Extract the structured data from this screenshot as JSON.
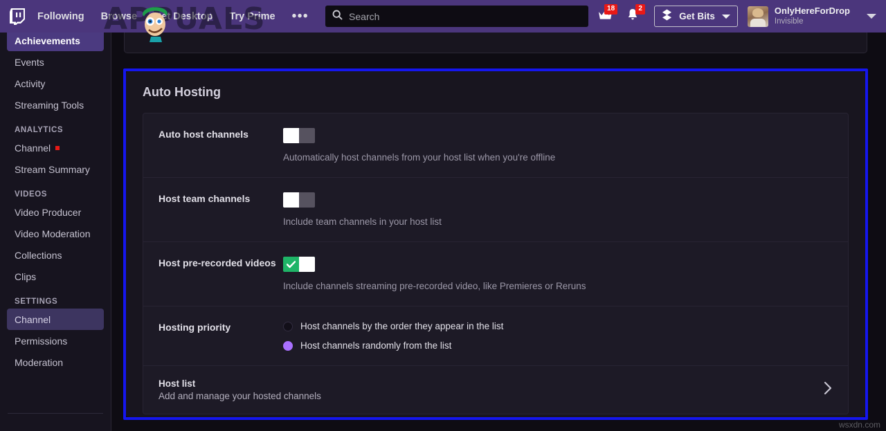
{
  "nav": {
    "logo": "twitch-logo",
    "links": [
      {
        "label": "Following"
      },
      {
        "label": "Browse"
      },
      {
        "label": "Get Desktop"
      },
      {
        "label": "Try Prime"
      }
    ],
    "more_label": "•••",
    "search": {
      "placeholder": "Search",
      "value": "",
      "icon": "search-icon"
    },
    "crown": {
      "icon": "crown-icon",
      "badge": "18"
    },
    "bell": {
      "icon": "bell-icon",
      "badge": "2"
    },
    "get_bits": {
      "label": "Get Bits",
      "icon": "bits-icon",
      "caret": "chevron-down-icon"
    },
    "user": {
      "name": "OnlyHereForDrop",
      "status": "Invisible",
      "caret": "chevron-down-icon"
    }
  },
  "watermarks": {
    "appuals": "APPUALS",
    "wsxdn": "wsxdn.com"
  },
  "sidebar": {
    "items": [
      {
        "label": "Achievements",
        "state": "active"
      },
      {
        "label": "Events",
        "state": "normal"
      },
      {
        "label": "Activity",
        "state": "normal"
      },
      {
        "label": "Streaming Tools",
        "state": "normal"
      }
    ],
    "analytics_heading": "ANALYTICS",
    "analytics_items": [
      {
        "label": "Channel",
        "dot": true
      },
      {
        "label": "Stream Summary",
        "dot": false
      }
    ],
    "videos_heading": "VIDEOS",
    "videos_items": [
      {
        "label": "Video Producer"
      },
      {
        "label": "Video Moderation"
      },
      {
        "label": "Collections"
      },
      {
        "label": "Clips"
      }
    ],
    "settings_heading": "SETTINGS",
    "settings_items": [
      {
        "label": "Channel",
        "state": "active-soft"
      },
      {
        "label": "Permissions",
        "state": "normal"
      },
      {
        "label": "Moderation",
        "state": "normal"
      }
    ]
  },
  "panel": {
    "title": "Auto Hosting",
    "rows": [
      {
        "label": "Auto host channels",
        "toggle_state": "off",
        "desc": "Automatically host channels from your host list when you're offline"
      },
      {
        "label": "Host team channels",
        "toggle_state": "off",
        "desc": "Include team channels in your host list"
      },
      {
        "label": "Host pre-recorded videos",
        "toggle_state": "on",
        "desc": "Include channels streaming pre-recorded video, like Premieres or Reruns"
      }
    ],
    "priority": {
      "label": "Hosting priority",
      "options": [
        {
          "label": "Host channels by the order they appear in the list",
          "selected": false
        },
        {
          "label": "Host channels randomly from the list",
          "selected": true
        }
      ]
    },
    "host_list": {
      "title": "Host list",
      "subtitle": "Add and manage your hosted channels",
      "chevron": "chevron-right-icon"
    }
  },
  "colors": {
    "brand_purple": "#4b367c",
    "accent_purple": "#a970ff",
    "toggle_on_green": "#1fb467",
    "badge_red": "#e91916",
    "annotation_blue": "#1516ee"
  }
}
